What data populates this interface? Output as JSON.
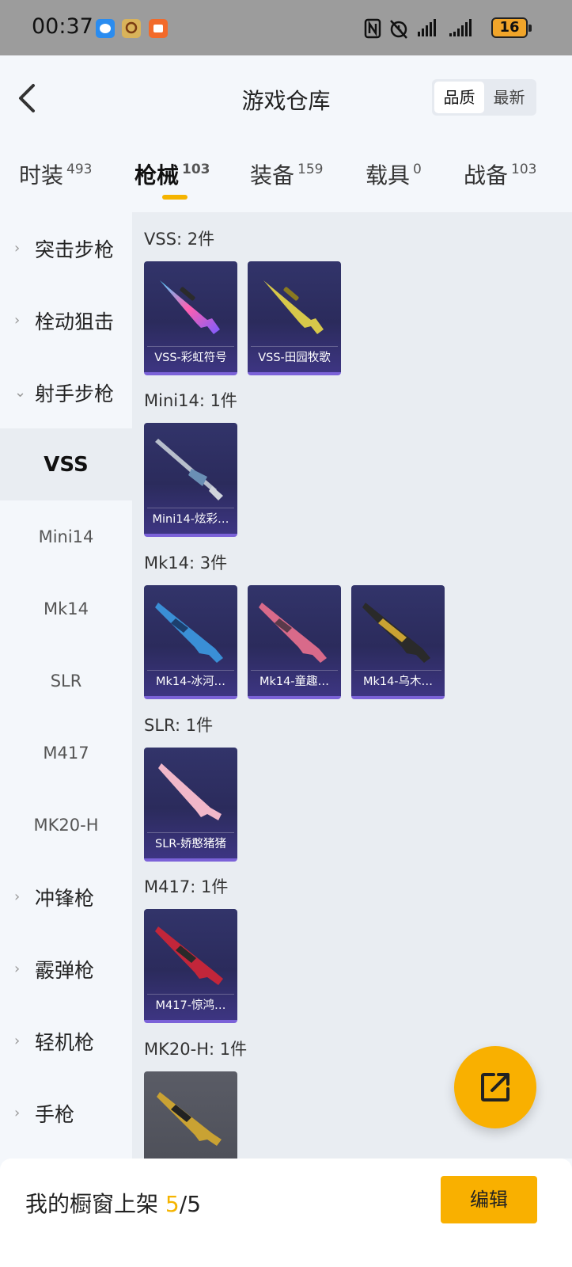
{
  "status_bar": {
    "time": "00:37",
    "battery": "16",
    "icons": [
      "chat-app-icon",
      "game-app-icon",
      "orange-app-icon",
      "nfc-icon",
      "alarm-icon",
      "signal-icon",
      "signal-icon"
    ]
  },
  "header": {
    "title": "游戏仓库",
    "sort_options": [
      {
        "label": "品质",
        "active": true
      },
      {
        "label": "最新",
        "active": false
      }
    ]
  },
  "tabs": [
    {
      "label": "时装",
      "count": "493",
      "active": false
    },
    {
      "label": "枪械",
      "count": "103",
      "active": true
    },
    {
      "label": "装备",
      "count": "159",
      "active": false
    },
    {
      "label": "载具",
      "count": "0",
      "active": false
    },
    {
      "label": "战备",
      "count": "103",
      "active": false
    }
  ],
  "sidebar": {
    "categories": [
      {
        "label": "突击步枪",
        "expanded": false
      },
      {
        "label": "栓动狙击",
        "expanded": false
      },
      {
        "label": "射手步枪",
        "expanded": true
      },
      {
        "label": "冲锋枪",
        "expanded": false
      },
      {
        "label": "霰弹枪",
        "expanded": false
      },
      {
        "label": "轻机枪",
        "expanded": false
      },
      {
        "label": "手枪",
        "expanded": false
      }
    ],
    "subitems": [
      "VSS",
      "Mini14",
      "Mk14",
      "SLR",
      "M417",
      "MK20-H"
    ],
    "selected_subitem": "VSS"
  },
  "groups": [
    {
      "title": "VSS: 2件",
      "items": [
        "VSS-彩虹符号",
        "VSS-田园牧歌"
      ]
    },
    {
      "title": "Mini14: 1件",
      "items": [
        "Mini14-炫彩…"
      ]
    },
    {
      "title": "Mk14: 3件",
      "items": [
        "Mk14-冰河…",
        "Mk14-童趣…",
        "Mk14-乌木…"
      ]
    },
    {
      "title": "SLR: 1件",
      "items": [
        "SLR-娇憨猪猪"
      ]
    },
    {
      "title": "M417: 1件",
      "items": [
        "M417-惊鸿…"
      ]
    },
    {
      "title": "MK20-H: 1件",
      "items": [
        ""
      ]
    }
  ],
  "bottom_bar": {
    "label": "我的橱窗上架",
    "count_current": "5",
    "count_sep": "/",
    "count_total": "5",
    "edit_label": "编辑"
  },
  "colors": {
    "accent": "#f9b000",
    "item_bg": "#2b2b5c",
    "item_border": "#7b62d8"
  }
}
